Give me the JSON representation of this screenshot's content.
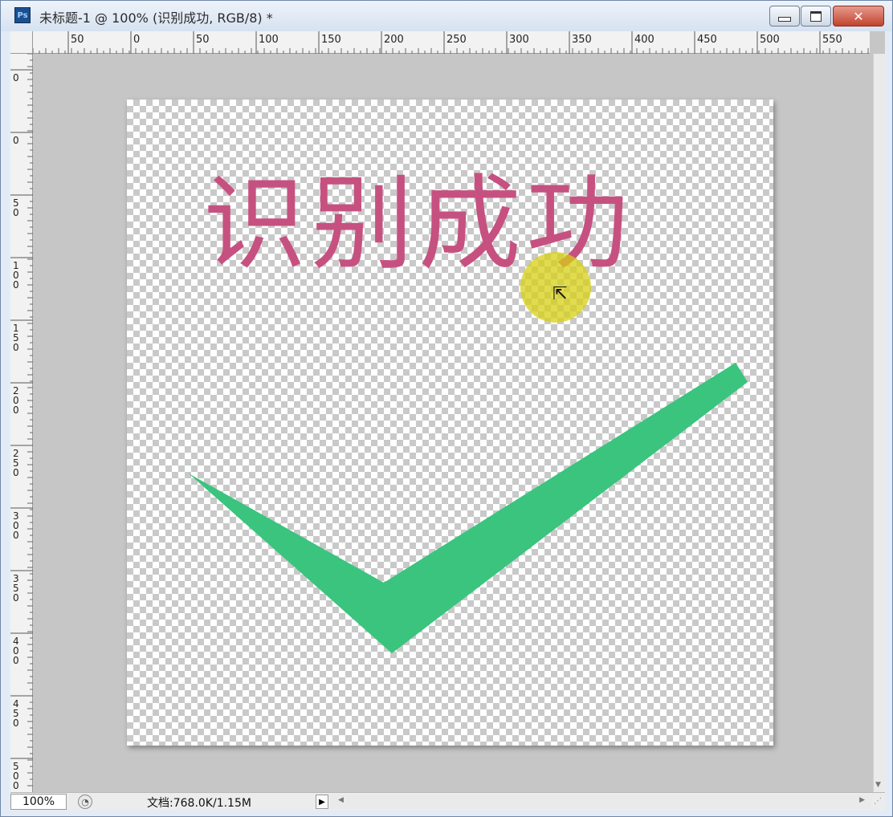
{
  "window": {
    "app_icon_label": "Ps",
    "title": "未标题-1 @ 100% (识别成功, RGB/8) *",
    "minimize_icon": "minimize-icon",
    "maximize_icon": "restore-icon",
    "close_glyph": "✕"
  },
  "rulers": {
    "horizontal_labels": [
      "50",
      "0",
      "50",
      "100",
      "150",
      "200",
      "250",
      "300",
      "350",
      "400",
      "450",
      "500",
      "550"
    ],
    "vertical_labels": [
      "0",
      "0",
      "5\n0",
      "1\n0\n0",
      "1\n5\n0",
      "2\n0\n0",
      "2\n5\n0",
      "3\n0\n0",
      "3\n5\n0",
      "4\n0\n0",
      "4\n5\n0",
      "5\n0\n0"
    ]
  },
  "canvas": {
    "text_layer": "识别成功",
    "text_color": "#c65180",
    "checkmark_color": "#3ac47d",
    "transparency_checker": "#c9c9c9",
    "cursor_icon": "move-cursor-icon",
    "cursor_highlight_color": "#d7d014"
  },
  "status": {
    "zoom": "100%",
    "doc_info": "文档:768.0K/1.15M",
    "arrow": "▶"
  }
}
